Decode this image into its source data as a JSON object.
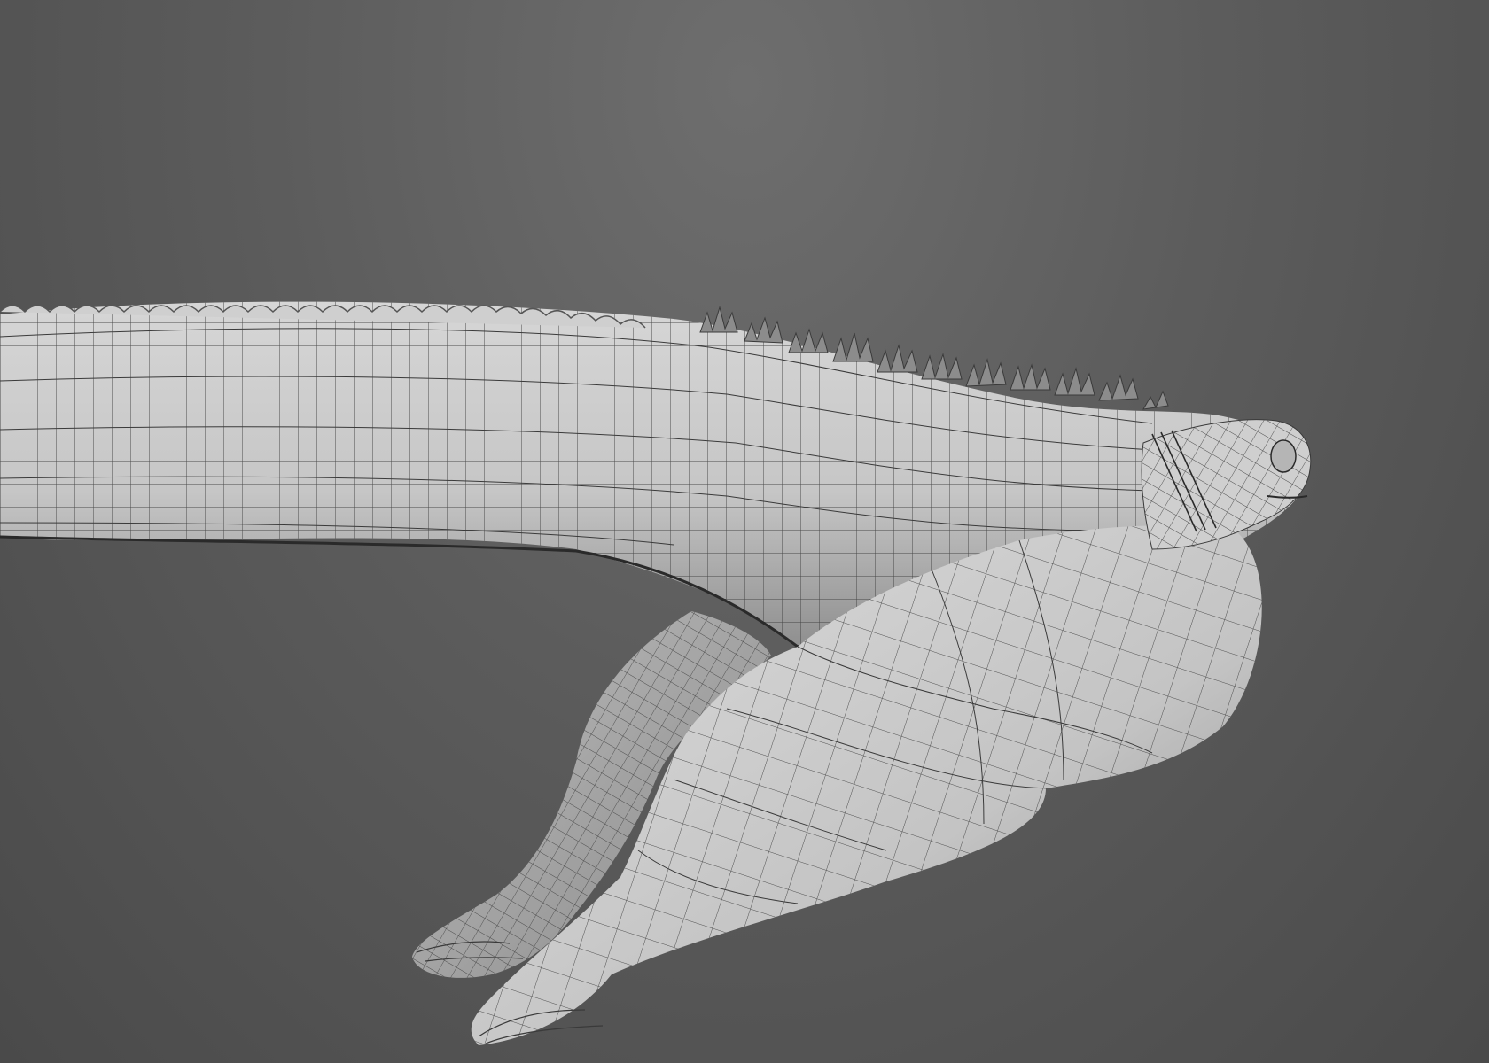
{
  "scene": {
    "subject": "wireframe-lizard-body",
    "render_mode": "wireframe-on-shaded",
    "colors": {
      "background_top": "#6e6e6e",
      "background_bottom": "#4a4a4a",
      "mesh_fill_light": "#d9d9d9",
      "mesh_fill_shadow": "#9a9a9a",
      "wire": "#3a3a3a",
      "spike": "#8c8c8c"
    }
  }
}
